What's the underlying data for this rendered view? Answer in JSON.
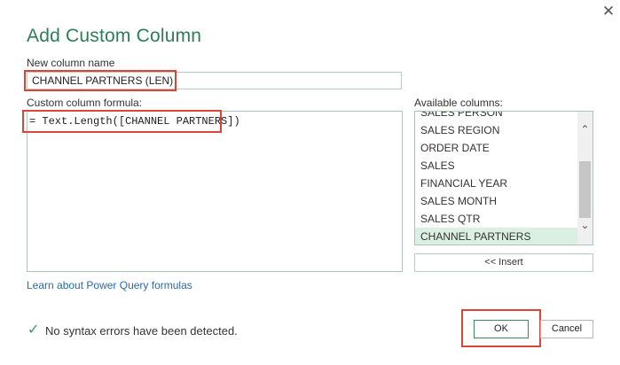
{
  "dialog": {
    "title": "Add Custom Column",
    "close_icon": "close-icon",
    "close_glyph": "✕"
  },
  "new_column": {
    "label": "New column name",
    "value": "CHANNEL PARTNERS (LEN)"
  },
  "formula": {
    "label": "Custom column formula:",
    "value": "= Text.Length([CHANNEL PARTNERS])"
  },
  "available_columns": {
    "label": "Available columns:",
    "items": [
      "SALES PERSON",
      "SALES REGION",
      "ORDER DATE",
      "SALES",
      "FINANCIAL YEAR",
      "SALES MONTH",
      "SALES QTR",
      "CHANNEL PARTNERS"
    ],
    "selected": "CHANNEL PARTNERS",
    "scroll_up_glyph": "⌃",
    "scroll_down_glyph": "⌄"
  },
  "insert_label": "<< Insert",
  "learn_link": "Learn about Power Query formulas",
  "status": {
    "icon": "checkmark-icon",
    "glyph": "✓",
    "text": "No syntax errors have been detected."
  },
  "buttons": {
    "ok_label": "OK",
    "cancel_label": "Cancel"
  },
  "colors": {
    "accent": "#2e7d56",
    "highlight": "#d9453b",
    "selected_bg": "#dcefe3",
    "link": "#2b6aa6"
  }
}
